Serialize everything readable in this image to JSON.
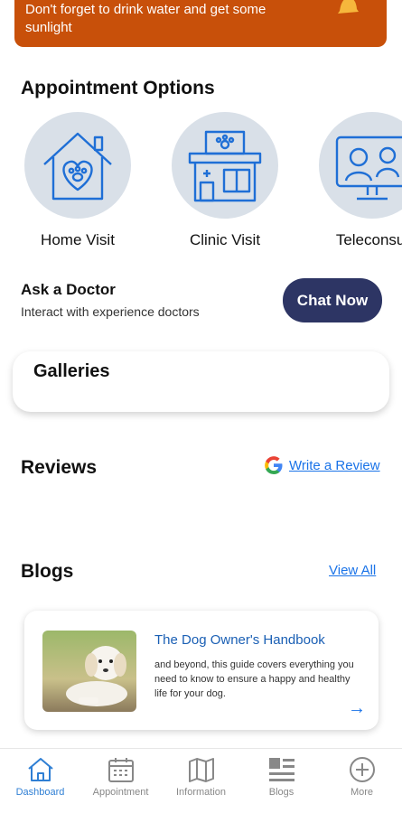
{
  "banner": {
    "line1": "Don't forget to drink water and get some",
    "line2": "sunlight"
  },
  "appointment": {
    "title": "Appointment Options",
    "options": [
      {
        "label": "Home Visit",
        "icon": "house-paw-icon"
      },
      {
        "label": "Clinic Visit",
        "icon": "clinic-icon"
      },
      {
        "label": "Teleconsul",
        "icon": "monitor-icon"
      }
    ]
  },
  "ask": {
    "title": "Ask a Doctor",
    "subtitle": "Interact with experience doctors",
    "button": "Chat Now"
  },
  "galleries": {
    "title": "Galleries"
  },
  "reviews": {
    "title": "Reviews",
    "link": "Write a Review"
  },
  "blogs": {
    "title": "Blogs",
    "link": "View All",
    "card": {
      "title": "The Dog Owner's Handbook",
      "desc": "and beyond, this guide covers everything you need to know to ensure a happy and healthy life for your dog."
    }
  },
  "nav": [
    {
      "label": "Dashboard",
      "active": true
    },
    {
      "label": "Appointment"
    },
    {
      "label": "Information"
    },
    {
      "label": "Blogs"
    },
    {
      "label": "More"
    }
  ],
  "colors": {
    "banner": "#c8500a",
    "button": "#2d3564",
    "link": "#1a73e8",
    "active_nav": "#2f7fd4"
  }
}
